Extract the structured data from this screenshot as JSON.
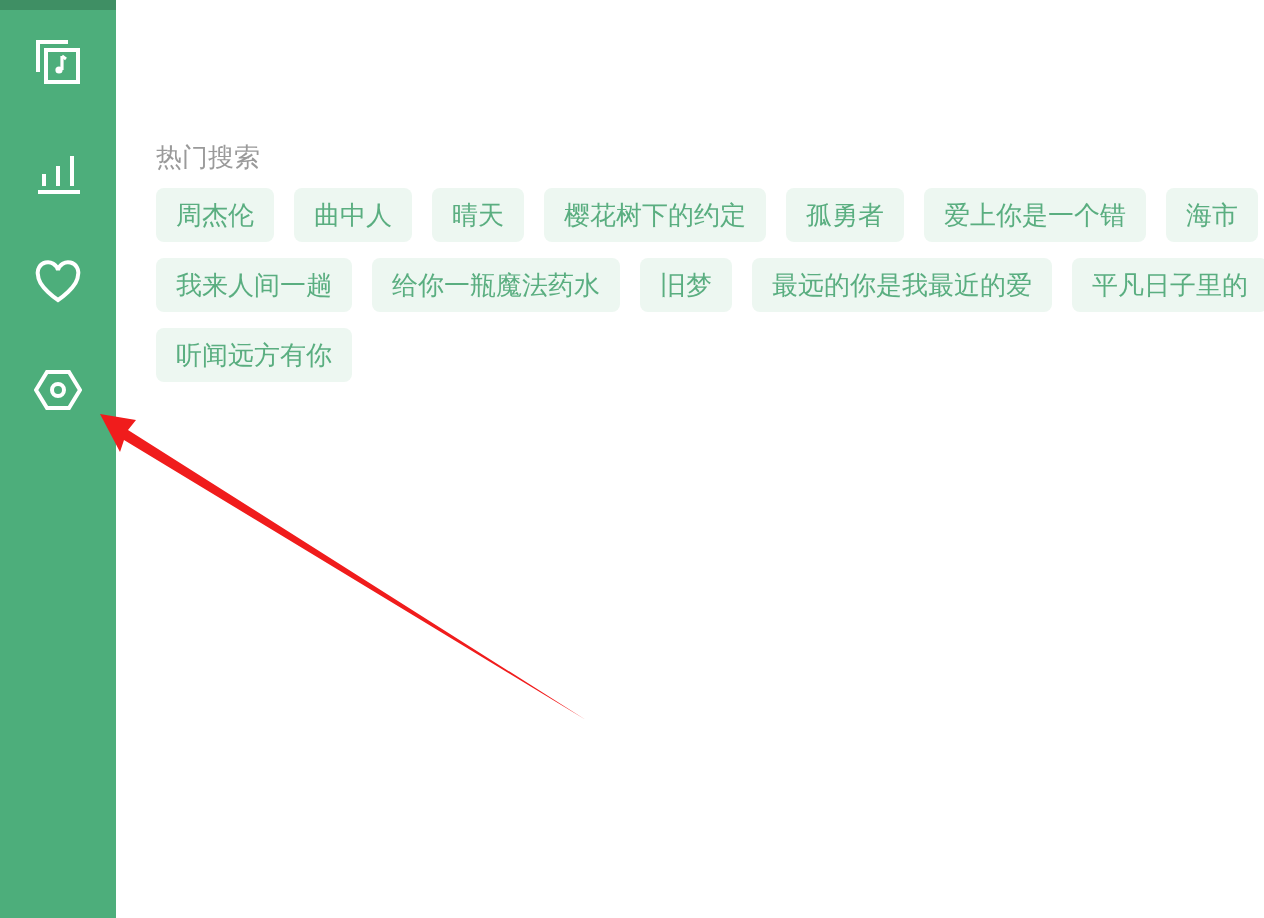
{
  "hot_search": {
    "title": "热门搜索",
    "tags": [
      {
        "label": "周杰伦"
      },
      {
        "label": "曲中人"
      },
      {
        "label": "晴天"
      },
      {
        "label": "樱花树下的约定"
      },
      {
        "label": "孤勇者"
      },
      {
        "label": "爱上你是一个错"
      },
      {
        "label": "海市"
      },
      {
        "label": "我来人间一趟"
      },
      {
        "label": "给你一瓶魔法药水"
      },
      {
        "label": "旧梦"
      },
      {
        "label": "最远的你是我最近的爱"
      },
      {
        "label": "平凡日子里的"
      },
      {
        "label": "听闻远方有你"
      }
    ]
  }
}
